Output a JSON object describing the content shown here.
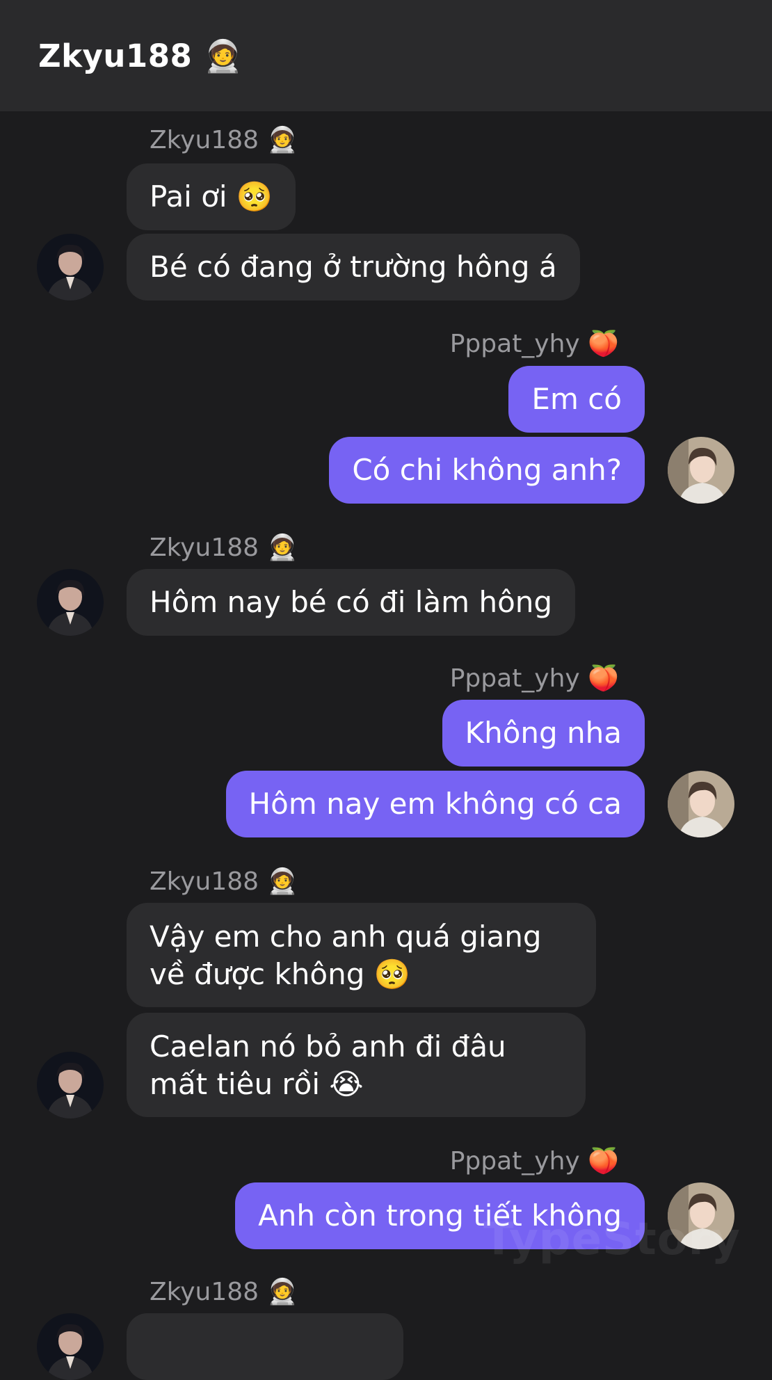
{
  "header": {
    "title": "Zkyu188 🧑‍🚀"
  },
  "messages": {
    "g1_sender": "Zkyu188 🧑‍🚀",
    "g1_m1": "Pai ơi 🥺",
    "g1_m2": "Bé có đang ở trường hông á",
    "g2_sender": "Pppat_yhy 🍑",
    "g2_m1": "Em có",
    "g2_m2": "Có chi không anh?",
    "g3_sender": "Zkyu188 🧑‍🚀",
    "g3_m1": "Hôm nay bé có đi làm hông",
    "g4_sender": "Pppat_yhy 🍑",
    "g4_m1": "Không nha",
    "g4_m2": "Hôm nay em không có ca",
    "g5_sender": "Zkyu188 🧑‍🚀",
    "g5_m1": "Vậy em cho anh quá giang về được không 🥺",
    "g5_m2": "Caelan nó bỏ anh đi đâu mất tiêu rồi 😭",
    "g6_sender": "Pppat_yhy 🍑",
    "g6_m1": "Anh còn trong tiết không",
    "g7_sender": "Zkyu188 🧑‍🚀"
  },
  "watermark": "TypeStory"
}
